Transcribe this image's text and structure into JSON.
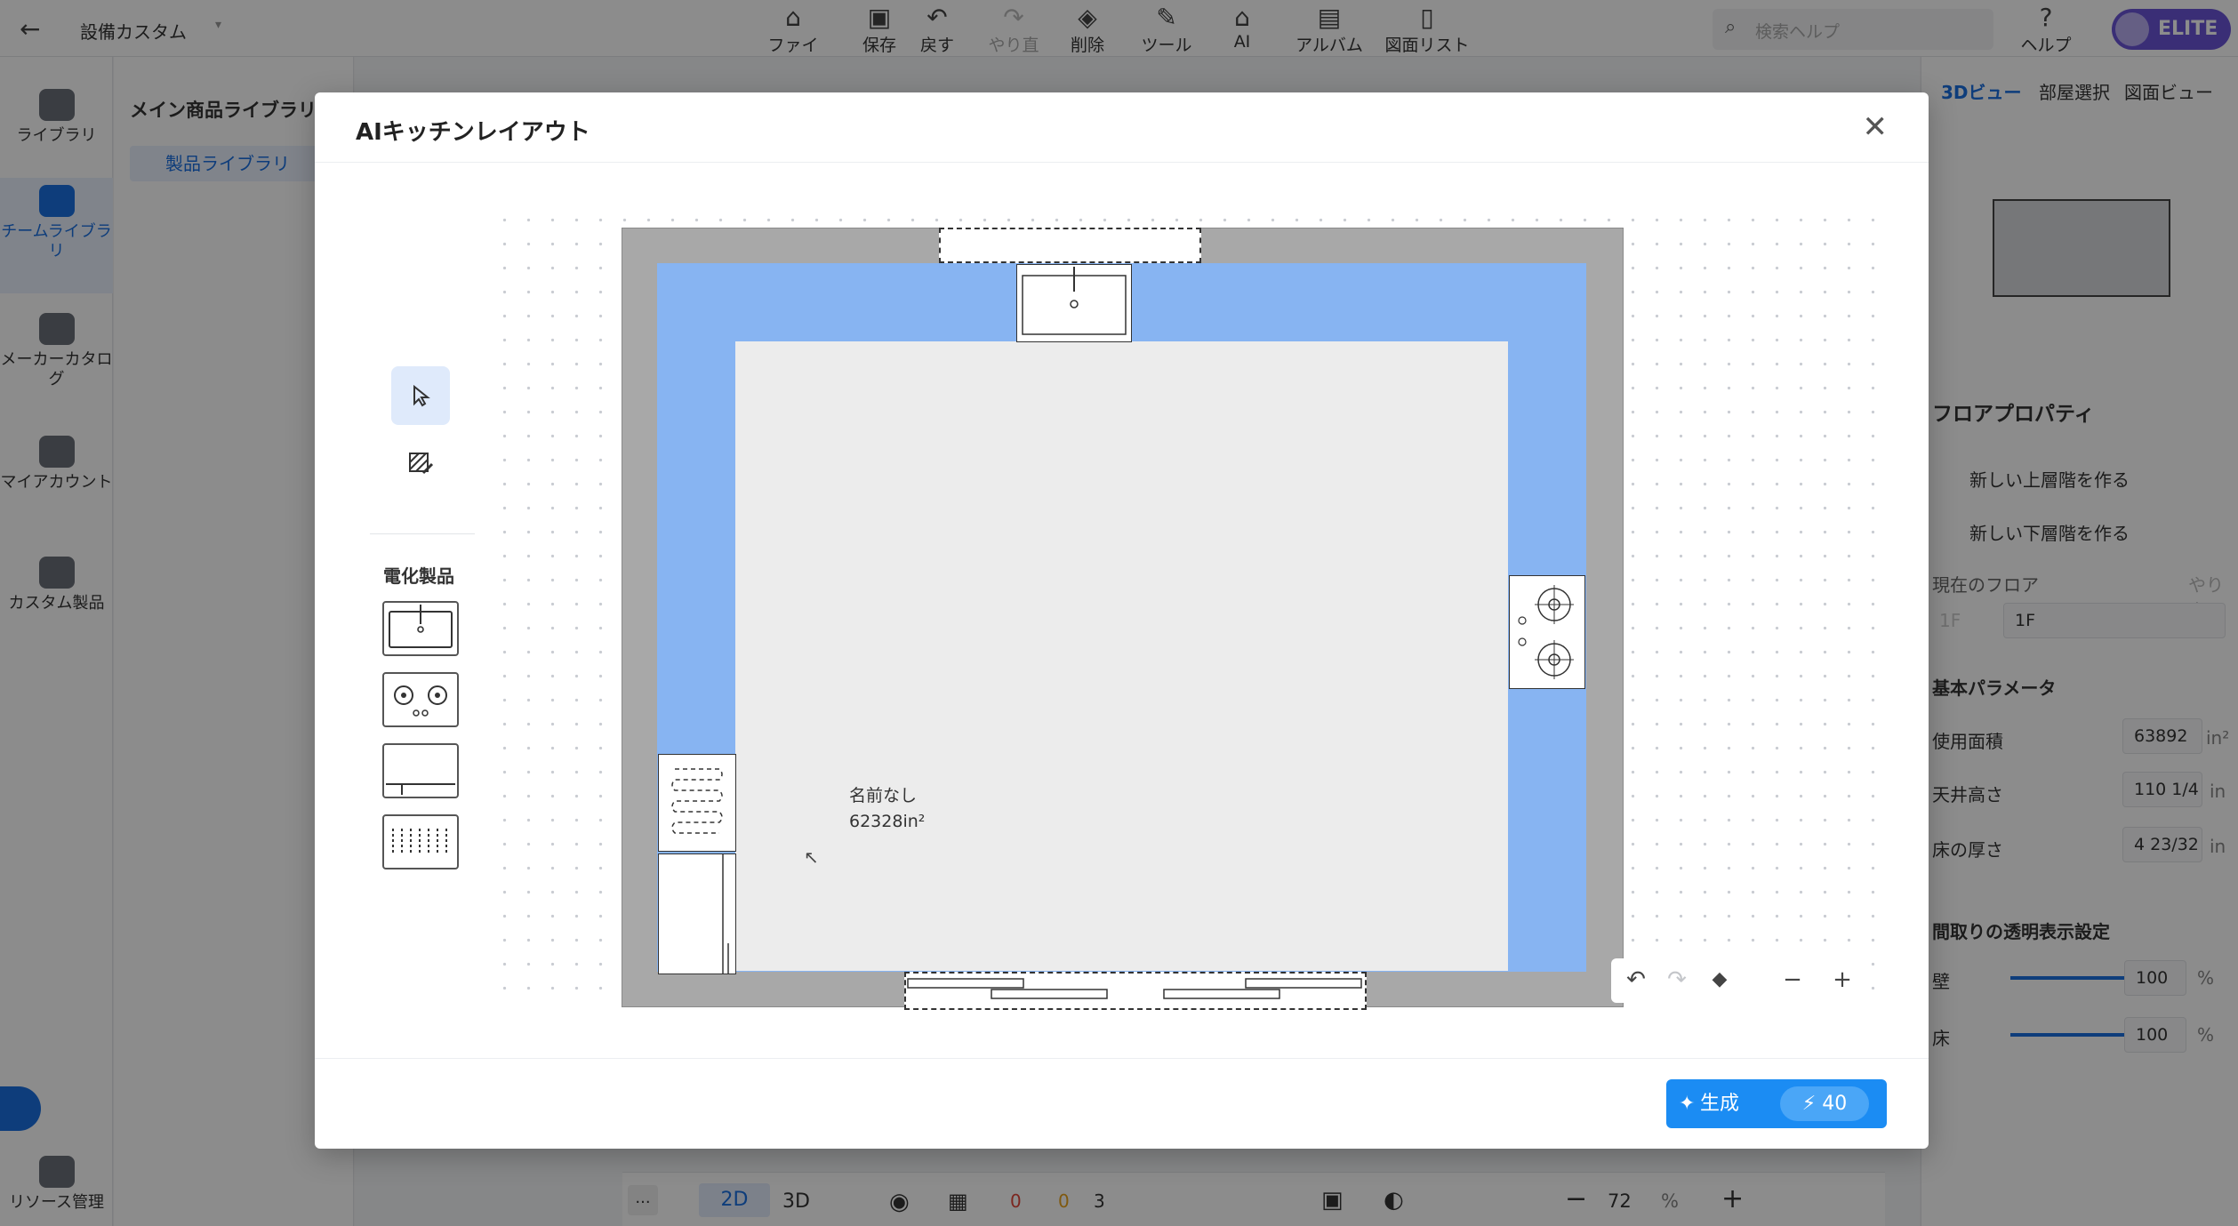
{
  "app": {
    "back_icon": "arrow-left-icon",
    "project_title": "設備カスタム"
  },
  "toolbar": {
    "file": "ファイル",
    "save": "保存",
    "undo": "戻す",
    "redo": "やり直す",
    "delete": "削除",
    "tools": "ツール",
    "ai": "AI",
    "album": "アルバム",
    "drawing_list": "図面リスト",
    "search_placeholder": "検索ヘルプ",
    "help": "ヘルプ",
    "plan_badge": "ELITE"
  },
  "leftrail": {
    "items": [
      {
        "label": "ライブラリ"
      },
      {
        "label": "チームライブラリ"
      },
      {
        "label": "メーカーカタログ"
      },
      {
        "label": "マイアカウント"
      },
      {
        "label": "カスタム製品"
      },
      {
        "label": "リソース管理"
      }
    ]
  },
  "library": {
    "heading": "メイン商品ライブラリ",
    "tab": "製品ライブラリ"
  },
  "rightpanel": {
    "tabs": [
      "3Dビュー",
      "部屋選択",
      "図面ビュー"
    ],
    "floor_props": "フロアプロパティ",
    "new_upper": "新しい上層階を作る",
    "new_lower": "新しい下層階を作る",
    "current_floor": "現在のフロア",
    "redo": "やり直す",
    "floor_ghost": "1F",
    "floor_value": "1F",
    "basic_params": "基本パラメータ",
    "area_label": "使用面積",
    "area_value": "63892",
    "area_unit": "in²",
    "ceiling_label": "天井高さ",
    "ceiling_value": "110 1/4",
    "ceiling_unit": "in",
    "floor_thick_label": "床の厚さ",
    "floor_thick_value": "4 23/32",
    "floor_thick_unit": "in",
    "transparency": "間取りの透明表示設定",
    "wall_label": "壁",
    "wall_value": "100",
    "floor_label": "床",
    "floor_pct": "100",
    "pct": "%",
    "wall_level": 1.0,
    "floor_level": 1.0
  },
  "bottombar": {
    "more": "...",
    "view2d": "2D",
    "view3d": "3D",
    "errors": "0",
    "warnings": "0",
    "info": "3",
    "zoom": "72",
    "zoom_unit": "%"
  },
  "modal": {
    "title": "AIキッチンレイアウト",
    "palette_category": "電化製品",
    "room_name": "名前なし",
    "room_area": "62328in²",
    "generate_label": "生成",
    "generate_cost": "40",
    "accent": "#1b8cf3",
    "wall_color": "#a8a8a8",
    "counter_color": "#87b4f2"
  }
}
